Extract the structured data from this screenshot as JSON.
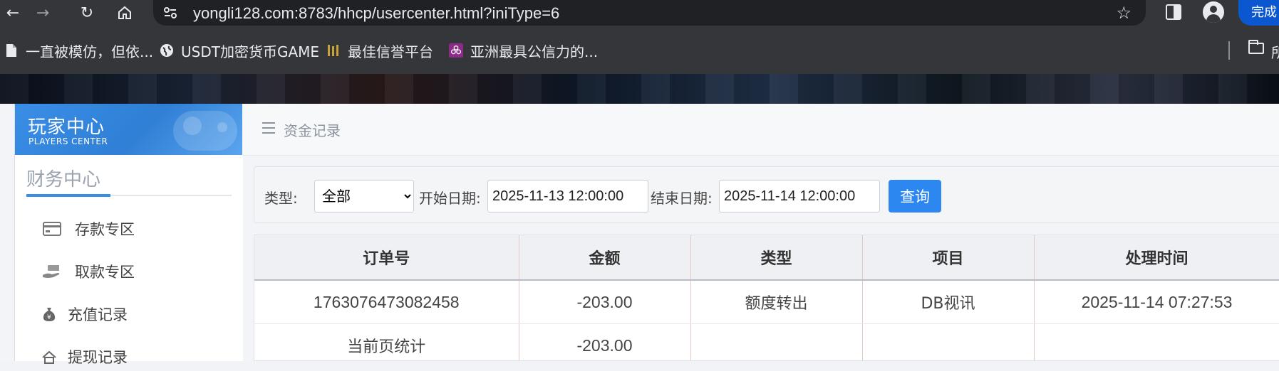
{
  "browser": {
    "url": "yongli128.com:8783/hhcp/usercenter.html?iniType=6",
    "done_label": "完成",
    "bookmarks": [
      {
        "label": "一直被模仿，但依...",
        "icon": "page-icon"
      },
      {
        "label": "USDT加密货币GAME",
        "icon": "globe-icon"
      },
      {
        "label": "最佳信誉平台",
        "icon": "brand-logo-icon"
      },
      {
        "label": "亚洲最具公信力的...",
        "icon": "flower-logo-icon"
      }
    ],
    "folder_label": "所"
  },
  "sidebar": {
    "title": "玩家中心",
    "subtitle": "PLAYERS CENTER",
    "section": "财务中心",
    "items": [
      {
        "label": "存款专区",
        "icon": "card-icon"
      },
      {
        "label": "取款专区",
        "icon": "cash-hand-icon"
      },
      {
        "label": "充值记录",
        "icon": "money-bag-icon"
      },
      {
        "label": "提现记录",
        "icon": "withdraw-icon"
      }
    ]
  },
  "content": {
    "title": "资金记录",
    "filter": {
      "type_label": "类型:",
      "type_value": "全部",
      "start_label": "开始日期:",
      "start_value": "2025-11-13 12:00:00",
      "end_label": "结束日期:",
      "end_value": "2025-11-14 12:00:00",
      "query_label": "查询"
    },
    "table": {
      "headers": [
        "订单号",
        "金额",
        "类型",
        "项目",
        "处理时间"
      ],
      "rows": [
        [
          "1763076473082458",
          "-203.00",
          "额度转出",
          "DB视讯",
          "2025-11-14 07:27:53"
        ]
      ],
      "summary": {
        "label": "当前页统计",
        "amount": "-203.00"
      }
    }
  },
  "colors": {
    "accent": "#2d87f0",
    "sidebar_header": "#3a8ee6",
    "chrome": "#35363a"
  }
}
